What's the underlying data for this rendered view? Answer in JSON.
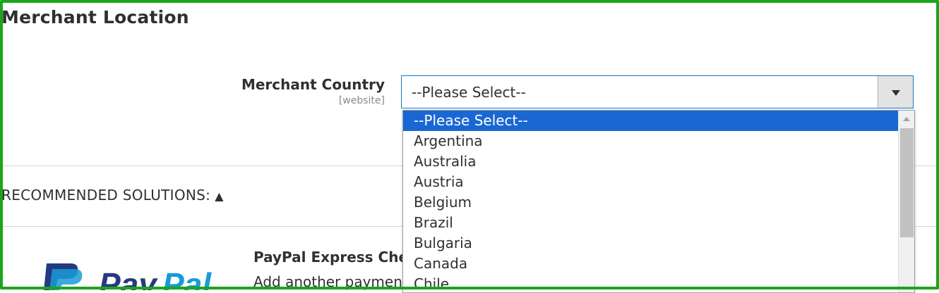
{
  "section": {
    "title": "Merchant Location"
  },
  "merchant_country": {
    "label": "Merchant Country",
    "scope": "[website]",
    "value": "--Please Select--"
  },
  "dropdown": {
    "options": [
      "--Please Select--",
      "Argentina",
      "Australia",
      "Austria",
      "Belgium",
      "Brazil",
      "Bulgaria",
      "Canada",
      "Chile"
    ],
    "selected_index": 0
  },
  "recommended": {
    "label": "RECOMMENDED SOLUTIONS:",
    "caret": "▲"
  },
  "paypal": {
    "title": "PayPal Express Chec",
    "description": "Add another payment",
    "logo_text": "PayPal"
  },
  "colors": {
    "frame": "#1aa51a",
    "selected_option": "#1967d2",
    "select_border": "#1979c3",
    "paypal_dark": "#253b80",
    "paypal_light": "#179bd7"
  }
}
